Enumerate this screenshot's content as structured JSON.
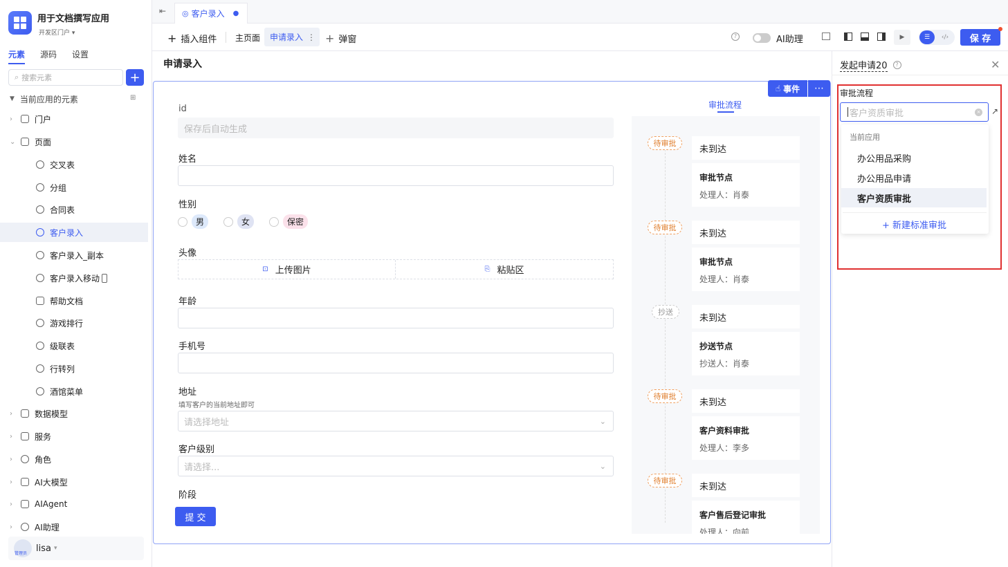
{
  "app": {
    "title": "用于文档撰写应用",
    "subtitle": "开发区门户 ▾"
  },
  "sidebar": {
    "tabs": [
      "元素",
      "源码",
      "设置"
    ],
    "search_placeholder": "搜索元素",
    "section_title": "当前应用的元素",
    "items": [
      {
        "label": "门户"
      },
      {
        "label": "页面"
      },
      {
        "label": "交叉表"
      },
      {
        "label": "分组"
      },
      {
        "label": "合同表"
      },
      {
        "label": "客户录入"
      },
      {
        "label": "客户录入_副本"
      },
      {
        "label": "客户录入移动"
      },
      {
        "label": "帮助文档"
      },
      {
        "label": "游戏排行"
      },
      {
        "label": "级联表"
      },
      {
        "label": "行转列"
      },
      {
        "label": "酒馆菜单"
      },
      {
        "label": "数据模型"
      },
      {
        "label": "服务"
      },
      {
        "label": "角色"
      },
      {
        "label": "AI大模型"
      },
      {
        "label": "AIAgent"
      },
      {
        "label": "AI助理"
      }
    ],
    "user": {
      "name": "lisa",
      "role": "管理员"
    }
  },
  "topbar": {
    "tab_label": "客户录入"
  },
  "toolbar": {
    "insert": "插入组件",
    "main_page": "主页面",
    "current_page": "申请录入",
    "popup": "弹窗",
    "ai_assistant": "AI助理",
    "save": "保 存"
  },
  "page": {
    "title": "申请录入",
    "event_btn": "事件",
    "submit": "提 交"
  },
  "form": {
    "id_label": "id",
    "id_placeholder": "保存后自动生成",
    "name_label": "姓名",
    "gender_label": "性别",
    "gender_options": [
      "男",
      "女",
      "保密"
    ],
    "avatar_label": "头像",
    "upload": "上传图片",
    "paste": "粘贴区",
    "age_label": "年龄",
    "phone_label": "手机号",
    "address_label": "地址",
    "address_hint": "填写客户的当前地址即可",
    "address_placeholder": "请选择地址",
    "level_label": "客户级别",
    "level_placeholder": "请选择...",
    "stage_label": "阶段"
  },
  "approval": {
    "tab": "审批流程",
    "steps": [
      {
        "status": "待审批",
        "state": "未到达",
        "node": "审批节点",
        "person": "处理人：肖泰"
      },
      {
        "status": "待审批",
        "state": "未到达",
        "node": "审批节点",
        "person": "处理人：肖泰"
      },
      {
        "status": "抄送",
        "state": "未到达",
        "node": "抄送节点",
        "person": "抄送人：肖泰"
      },
      {
        "status": "待审批",
        "state": "未到达",
        "node": "客户资料审批",
        "person": "处理人：李多"
      },
      {
        "status": "待审批",
        "state": "未到达",
        "node": "客户售后登记审批",
        "person": "处理人：向前"
      }
    ]
  },
  "right_panel": {
    "title": "发起申请20",
    "field_label": "审批流程",
    "input_placeholder": "客户资质审批",
    "group_label": "当前应用",
    "options": [
      "办公用品采购",
      "办公用品申请",
      "客户资质审批"
    ],
    "new_link": "+ 新建标准审批"
  }
}
